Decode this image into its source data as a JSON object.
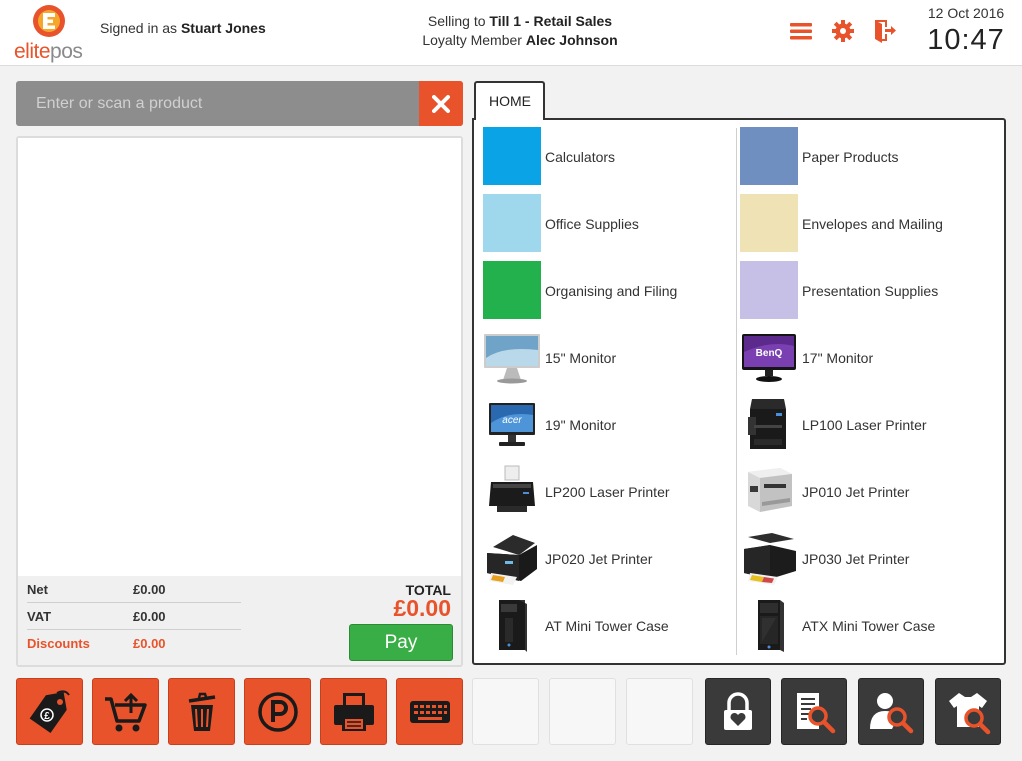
{
  "header": {
    "logo": {
      "part1": "elite",
      "part2": "pos"
    },
    "signed_in_prefix": "Signed in as",
    "user_name": "Stuart Jones",
    "selling_prefix": "Selling to",
    "till_name": "Till 1 - Retail Sales",
    "loyalty_prefix": "Loyalty Member",
    "loyalty_member": "Alec Johnson",
    "icons": [
      "menu-icon",
      "gear-icon",
      "logout-icon"
    ],
    "date": "12 Oct 2016",
    "time": "10:47"
  },
  "scan": {
    "placeholder": "Enter or scan a product",
    "value": ""
  },
  "totals": {
    "net_label": "Net",
    "net_value": "£0.00",
    "vat_label": "VAT",
    "vat_value": "£0.00",
    "discounts_label": "Discounts",
    "discounts_value": "£0.00",
    "total_label": "TOTAL",
    "total_value": "£0.00",
    "pay_label": "Pay"
  },
  "catalog": {
    "tab": "HOME",
    "left": [
      {
        "label": "Calculators",
        "color": "#0aa3e6"
      },
      {
        "label": "Office Supplies",
        "color": "#9fd8ec"
      },
      {
        "label": "Organising and Filing",
        "color": "#22b14c"
      },
      {
        "label": "15\" Monitor",
        "icon": "monitor-icon"
      },
      {
        "label": "19\" Monitor",
        "icon": "monitor-icon"
      },
      {
        "label": "LP200 Laser Printer",
        "icon": "printer-icon"
      },
      {
        "label": "JP020 Jet Printer",
        "icon": "printer-icon"
      },
      {
        "label": "AT Mini Tower Case",
        "icon": "tower-case-icon"
      }
    ],
    "right": [
      {
        "label": "Paper Products",
        "color": "#6f8fc0"
      },
      {
        "label": "Envelopes and Mailing",
        "color": "#efe3b6"
      },
      {
        "label": "Presentation Supplies",
        "color": "#c6bfe6"
      },
      {
        "label": "17\" Monitor",
        "icon": "monitor-icon"
      },
      {
        "label": "LP100 Laser Printer",
        "icon": "printer-icon"
      },
      {
        "label": "JP010 Jet Printer",
        "icon": "printer-icon"
      },
      {
        "label": "JP030 Jet Printer",
        "icon": "printer-icon"
      },
      {
        "label": "ATX Mini Tower Case",
        "icon": "tower-case-icon"
      }
    ]
  },
  "bottom_bar": {
    "orange_buttons": [
      "discount-tag-icon",
      "refund-cart-icon",
      "void-bin-icon",
      "park-icon",
      "print-icon",
      "keyboard-icon"
    ],
    "dark_buttons": [
      "lock-icon",
      "receipt-search-icon",
      "customer-search-icon",
      "product-search-icon"
    ]
  },
  "colors": {
    "accent": "#e8532b",
    "pay": "#3aae46",
    "dark_button": "#3a3a3a"
  }
}
